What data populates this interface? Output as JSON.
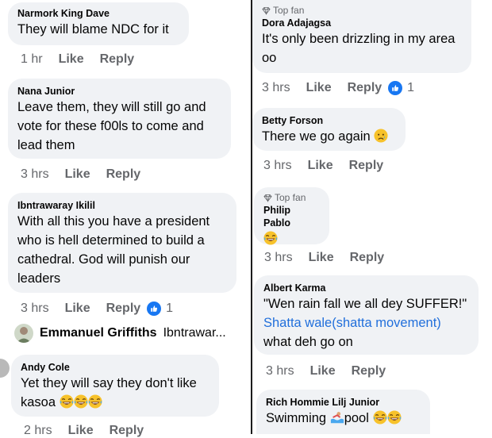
{
  "left": {
    "c1": {
      "name": "Narmork King Dave",
      "text": "They will blame NDC for it",
      "time": "1 hr",
      "like": "Like",
      "reply": "Reply"
    },
    "c2": {
      "name": "Nana Junior",
      "lines": [
        "Leave them, they will still go and",
        "vote for these f00ls to come and",
        "lead them"
      ],
      "time": "3 hrs",
      "like": "Like",
      "reply": "Reply"
    },
    "c3": {
      "name": "Ibntrawaray Ikilil",
      "lines": [
        "With all this you have  a president",
        "who is hell determined to build a",
        "cathedral. God will punish our",
        "leaders"
      ],
      "time": "3 hrs",
      "like": "Like",
      "reply": "Reply",
      "reactions": "1"
    },
    "reply_preview": {
      "name": "Emmanuel Griffiths",
      "text": "Ibntrawar..."
    },
    "c4": {
      "name": "Andy Cole",
      "lines": [
        "Yet they will say they don't like",
        "kasoa"
      ],
      "time": "2 hrs",
      "like": "Like",
      "reply": "Reply"
    }
  },
  "right": {
    "c1": {
      "badge": "Top fan",
      "name": "Dora Adajagsa",
      "lines": [
        "It's only been drizzling in my area",
        "oo"
      ],
      "time": "3 hrs",
      "like": "Like",
      "reply": "Reply",
      "reactions": "1"
    },
    "c2": {
      "name": "Betty Forson",
      "text": "There we go again",
      "time": "3 hrs",
      "like": "Like",
      "reply": "Reply"
    },
    "c3": {
      "badge": "Top fan",
      "name": "Philip Pablo",
      "time": "3 hrs",
      "like": "Like",
      "reply": "Reply"
    },
    "c4": {
      "name": "Albert Karma",
      "lines": [
        "\"Wen rain fall we all dey SUFFER!\"",
        "Shatta wale(shatta movement)",
        "what deh go on"
      ],
      "time": "3 hrs",
      "like": "Like",
      "reply": "Reply"
    },
    "c5": {
      "name": "Rich Hommie Lilj Junior",
      "text_a": "Swimming",
      "text_b": "pool"
    }
  },
  "colors": {
    "bubble": "#f0f2f5",
    "meta": "#65676b",
    "link": "#216fdb",
    "like_badge": "#1877f2"
  }
}
